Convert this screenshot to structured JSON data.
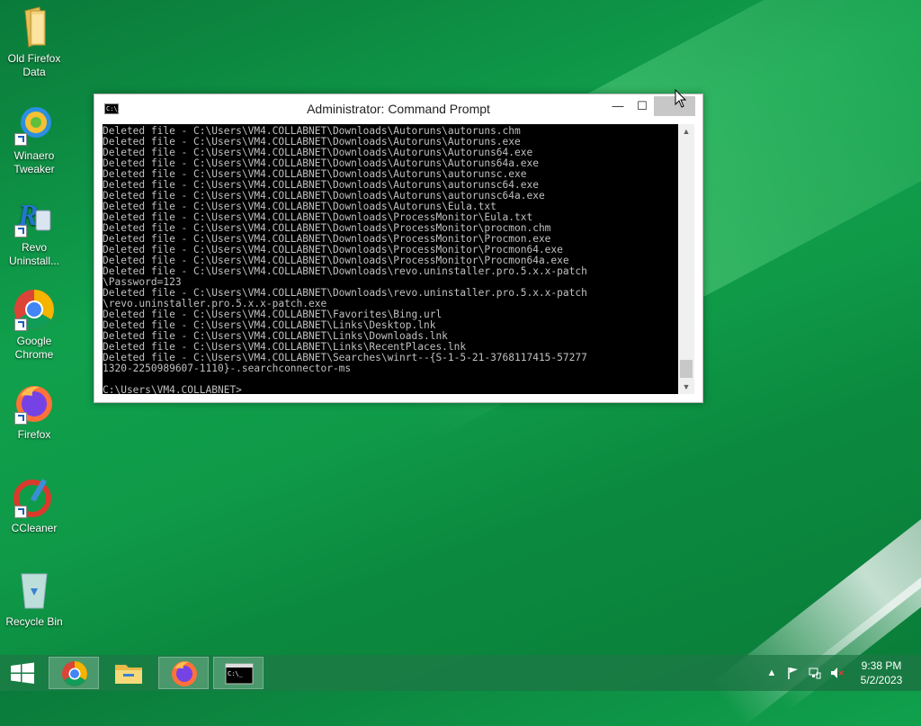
{
  "desktop": {
    "icons": [
      {
        "label_line1": "Old Firefox",
        "label_line2": "Data",
        "icon": "folder-icon"
      },
      {
        "label_line1": "Winaero",
        "label_line2": "Tweaker",
        "icon": "winaero-tweaker-icon"
      },
      {
        "label_line1": "Revo",
        "label_line2": "Uninstall...",
        "icon": "revo-uninstaller-icon"
      },
      {
        "label_line1": "Google",
        "label_line2": "Chrome",
        "icon": "chrome-icon"
      },
      {
        "label_line1": "Firefox",
        "label_line2": "",
        "icon": "firefox-icon"
      },
      {
        "label_line1": "CCleaner",
        "label_line2": "",
        "icon": "ccleaner-icon"
      },
      {
        "label_line1": "Recycle Bin",
        "label_line2": "",
        "icon": "recycle-bin-icon"
      }
    ]
  },
  "cmd": {
    "title": "Administrator: Command Prompt",
    "icon_text": "C:\\_",
    "output": "Deleted file - C:\\Users\\VM4.COLLABNET\\Downloads\\Autoruns\\autoruns.chm\nDeleted file - C:\\Users\\VM4.COLLABNET\\Downloads\\Autoruns\\Autoruns.exe\nDeleted file - C:\\Users\\VM4.COLLABNET\\Downloads\\Autoruns\\Autoruns64.exe\nDeleted file - C:\\Users\\VM4.COLLABNET\\Downloads\\Autoruns\\Autoruns64a.exe\nDeleted file - C:\\Users\\VM4.COLLABNET\\Downloads\\Autoruns\\autorunsc.exe\nDeleted file - C:\\Users\\VM4.COLLABNET\\Downloads\\Autoruns\\autorunsc64.exe\nDeleted file - C:\\Users\\VM4.COLLABNET\\Downloads\\Autoruns\\autorunsc64a.exe\nDeleted file - C:\\Users\\VM4.COLLABNET\\Downloads\\Autoruns\\Eula.txt\nDeleted file - C:\\Users\\VM4.COLLABNET\\Downloads\\ProcessMonitor\\Eula.txt\nDeleted file - C:\\Users\\VM4.COLLABNET\\Downloads\\ProcessMonitor\\procmon.chm\nDeleted file - C:\\Users\\VM4.COLLABNET\\Downloads\\ProcessMonitor\\Procmon.exe\nDeleted file - C:\\Users\\VM4.COLLABNET\\Downloads\\ProcessMonitor\\Procmon64.exe\nDeleted file - C:\\Users\\VM4.COLLABNET\\Downloads\\ProcessMonitor\\Procmon64a.exe\nDeleted file - C:\\Users\\VM4.COLLABNET\\Downloads\\revo.uninstaller.pro.5.x.x-patch\n\\Password=123\nDeleted file - C:\\Users\\VM4.COLLABNET\\Downloads\\revo.uninstaller.pro.5.x.x-patch\n\\revo.uninstaller.pro.5.x.x-patch.exe\nDeleted file - C:\\Users\\VM4.COLLABNET\\Favorites\\Bing.url\nDeleted file - C:\\Users\\VM4.COLLABNET\\Links\\Desktop.lnk\nDeleted file - C:\\Users\\VM4.COLLABNET\\Links\\Downloads.lnk\nDeleted file - C:\\Users\\VM4.COLLABNET\\Links\\RecentPlaces.lnk\nDeleted file - C:\\Users\\VM4.COLLABNET\\Searches\\winrt--{S-1-5-21-3768117415-57277\n1320-2250989607-1110}-.searchconnector-ms\n\nC:\\Users\\VM4.COLLABNET>",
    "buttons": {
      "minimize": "—",
      "maximize": "☐",
      "close": "✕"
    }
  },
  "taskbar": {
    "items": [
      {
        "icon": "chrome-icon",
        "active": true
      },
      {
        "icon": "file-explorer-icon",
        "active": false
      },
      {
        "icon": "firefox-icon",
        "active": true
      },
      {
        "icon": "command-prompt-icon",
        "active": true
      }
    ],
    "tray": {
      "chevron": "▲",
      "time": "9:38 PM",
      "date": "5/2/2023"
    }
  },
  "colors": {
    "wallpaper_green": "#0f9a48",
    "console_bg": "#000000",
    "console_text": "#c0c0c0"
  }
}
